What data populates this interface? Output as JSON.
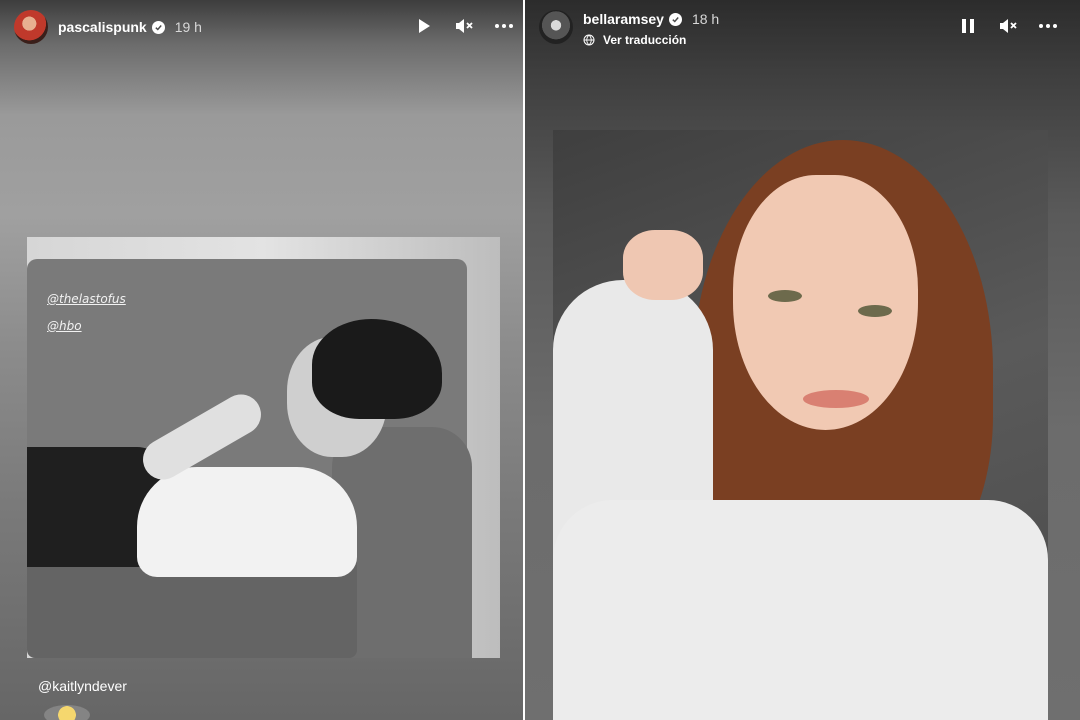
{
  "left_story": {
    "username": "pascalispunk",
    "time": "19 h",
    "mentions": [
      "@thelastofus",
      "@hbo"
    ],
    "caption": "@kaitlyndever",
    "controls": {
      "play": "play-icon",
      "mute": "mute-icon",
      "more": "more-icon"
    }
  },
  "right_story": {
    "username": "bellaramsey",
    "time": "18 h",
    "translate": "Ver traducción",
    "controls": {
      "pause": "pause-icon",
      "mute": "mute-icon",
      "more": "more-icon"
    }
  }
}
